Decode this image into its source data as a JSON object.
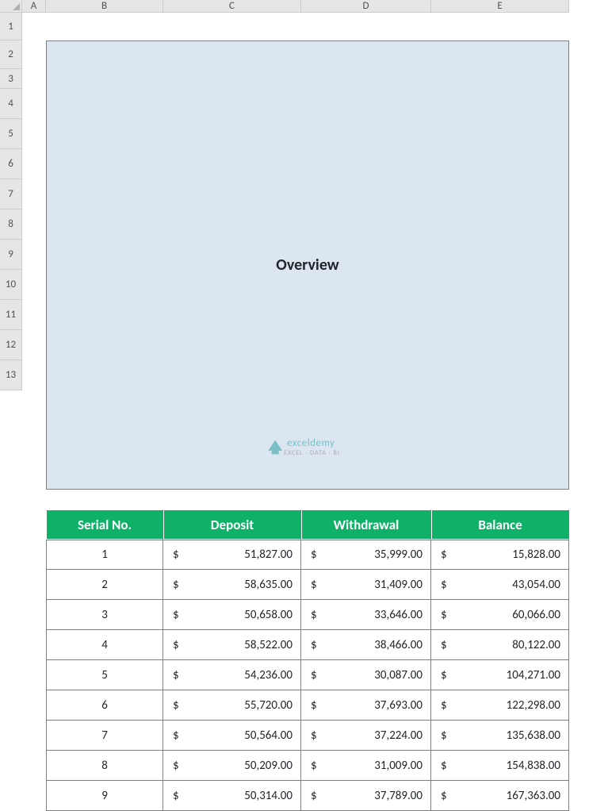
{
  "columns": [
    "A",
    "B",
    "C",
    "D",
    "E"
  ],
  "rows": [
    "1",
    "2",
    "3",
    "4",
    "5",
    "6",
    "7",
    "8",
    "9",
    "10",
    "11",
    "12",
    "13"
  ],
  "title": "Overview",
  "headers": {
    "serial": "Serial No.",
    "deposit": "Deposit",
    "withdrawal": "Withdrawal",
    "balance": "Balance"
  },
  "currency_symbol": "$",
  "data": [
    {
      "serial": "1",
      "deposit": "51,827.00",
      "withdrawal": "35,999.00",
      "balance": "15,828.00"
    },
    {
      "serial": "2",
      "deposit": "58,635.00",
      "withdrawal": "31,409.00",
      "balance": "43,054.00"
    },
    {
      "serial": "3",
      "deposit": "50,658.00",
      "withdrawal": "33,646.00",
      "balance": "60,066.00"
    },
    {
      "serial": "4",
      "deposit": "58,522.00",
      "withdrawal": "38,466.00",
      "balance": "80,122.00"
    },
    {
      "serial": "5",
      "deposit": "54,236.00",
      "withdrawal": "30,087.00",
      "balance": "104,271.00"
    },
    {
      "serial": "6",
      "deposit": "55,720.00",
      "withdrawal": "37,693.00",
      "balance": "122,298.00"
    },
    {
      "serial": "7",
      "deposit": "50,564.00",
      "withdrawal": "37,224.00",
      "balance": "135,638.00"
    },
    {
      "serial": "8",
      "deposit": "50,209.00",
      "withdrawal": "31,009.00",
      "balance": "154,838.00"
    },
    {
      "serial": "9",
      "deposit": "50,314.00",
      "withdrawal": "37,789.00",
      "balance": "167,363.00"
    }
  ],
  "watermark": {
    "brand": "exceldemy",
    "tagline": "EXCEL · DATA · BI"
  },
  "colors": {
    "header_bg": "#0fb068",
    "title_bg": "#dce6f1"
  },
  "chart_data": {
    "type": "table",
    "title": "Overview",
    "columns": [
      "Serial No.",
      "Deposit",
      "Withdrawal",
      "Balance"
    ],
    "rows": [
      [
        1,
        51827.0,
        35999.0,
        15828.0
      ],
      [
        2,
        58635.0,
        31409.0,
        43054.0
      ],
      [
        3,
        50658.0,
        33646.0,
        60066.0
      ],
      [
        4,
        58522.0,
        38466.0,
        80122.0
      ],
      [
        5,
        54236.0,
        30087.0,
        104271.0
      ],
      [
        6,
        55720.0,
        37693.0,
        122298.0
      ],
      [
        7,
        50564.0,
        37224.0,
        135638.0
      ],
      [
        8,
        50209.0,
        31009.0,
        154838.0
      ],
      [
        9,
        50314.0,
        37789.0,
        167363.0
      ]
    ]
  }
}
